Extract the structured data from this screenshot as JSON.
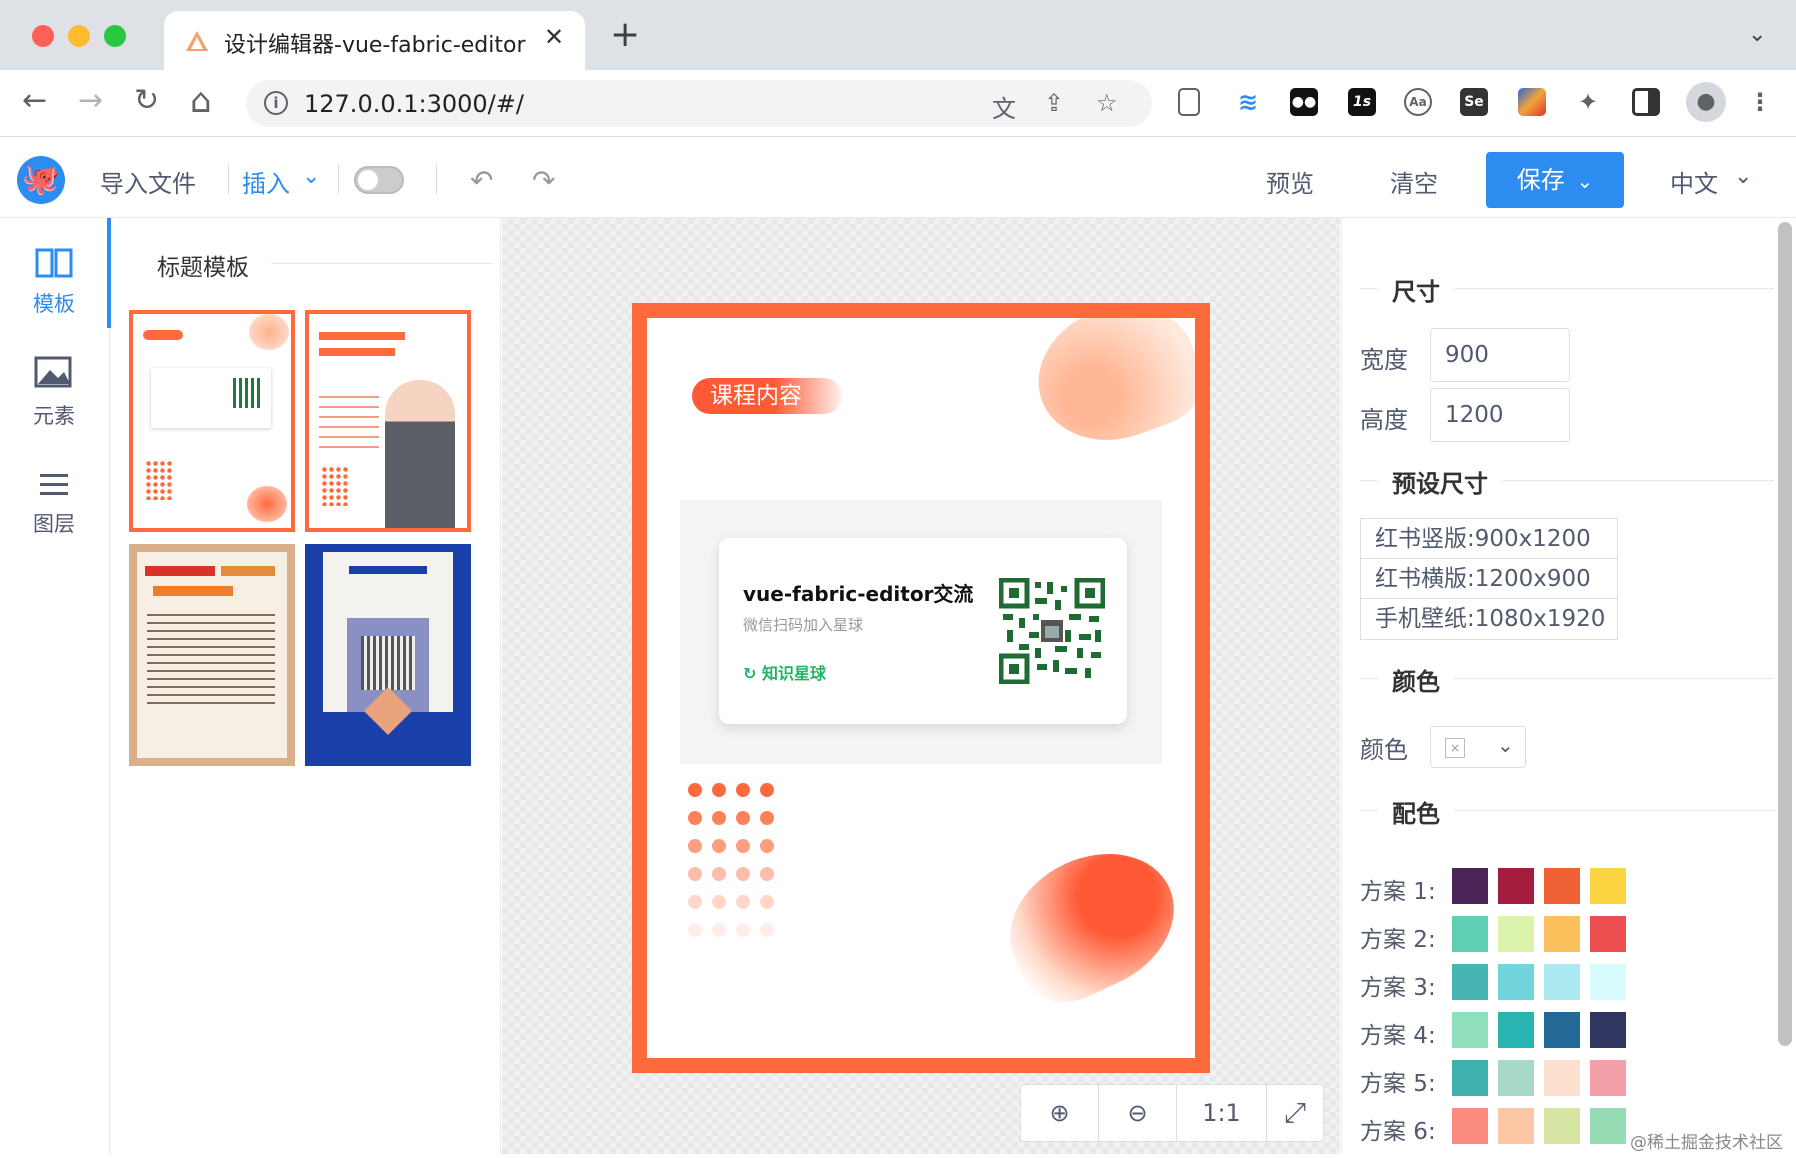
{
  "browser": {
    "tab_title": "设计编辑器-vue-fabric-editor",
    "tab_close": "✕",
    "new_tab": "+",
    "url": "127.0.0.1:3000/#/",
    "tab_menu": "⌄",
    "back": "←",
    "forward": "→",
    "reload": "↻",
    "home": "⌂",
    "extensions": [
      "1s",
      "Se"
    ]
  },
  "toolbar": {
    "import_label": "导入文件",
    "insert_label": "插入",
    "chevron": "⌄",
    "undo": "↶",
    "redo": "↷",
    "preview_label": "预览",
    "clear_label": "清空",
    "save_label": "保存",
    "lang_label": "中文"
  },
  "leftnav": {
    "items": [
      {
        "icon": "book-icon",
        "label": "模板"
      },
      {
        "icon": "image-icon",
        "label": "元素"
      },
      {
        "icon": "layers-icon",
        "label": "图层"
      }
    ]
  },
  "templates": {
    "title": "标题模板",
    "items": [
      {
        "name": "course-template"
      },
      {
        "name": "study-method-template"
      },
      {
        "name": "hotel-guide-template"
      },
      {
        "name": "open-source-invite-template"
      }
    ]
  },
  "canvas": {
    "badge": "课程内容",
    "card_title": "vue-fabric-editor交流",
    "card_sub": "微信扫码加入星球",
    "card_brand": "知识星球",
    "colors": {
      "frame": "#ff6a3d",
      "brand_green": "#1db564"
    }
  },
  "zoom": {
    "zoom_in": "⊕",
    "zoom_out": "⊖",
    "reset": "1:1",
    "fit": "⤢"
  },
  "properties": {
    "size_title": "尺寸",
    "width_label": "宽度",
    "width_value": "900",
    "height_label": "高度",
    "height_value": "1200",
    "preset_title": "预设尺寸",
    "presets": [
      "红书竖版:900x1200",
      "红书横版:1200x900",
      "手机壁纸:1080x1920"
    ],
    "color_title": "颜色",
    "color_label": "颜色",
    "palette_title": "配色",
    "schemes": [
      {
        "label": "方案 1:",
        "colors": [
          "#4a2456",
          "#a31c3d",
          "#ef6134",
          "#fbd240"
        ]
      },
      {
        "label": "方案 2:",
        "colors": [
          "#5fcfb3",
          "#dcf3ab",
          "#f9c05b",
          "#ec4d4f"
        ]
      },
      {
        "label": "方案 3:",
        "colors": [
          "#47b5b1",
          "#72d4dc",
          "#aaeaf0",
          "#d8fcfd"
        ]
      },
      {
        "label": "方案 4:",
        "colors": [
          "#8fdfbd",
          "#28b5b2",
          "#236996",
          "#313660"
        ]
      },
      {
        "label": "方案 5:",
        "colors": [
          "#3fb0ab",
          "#a8d8c8",
          "#fde0d0",
          "#f4a0a8"
        ]
      },
      {
        "label": "方案 6:",
        "colors": [
          "#fb8a80",
          "#fdc6a4",
          "#d6e4a4",
          "#95dbb4"
        ]
      }
    ]
  },
  "watermark": "@稀土掘金技术社区"
}
